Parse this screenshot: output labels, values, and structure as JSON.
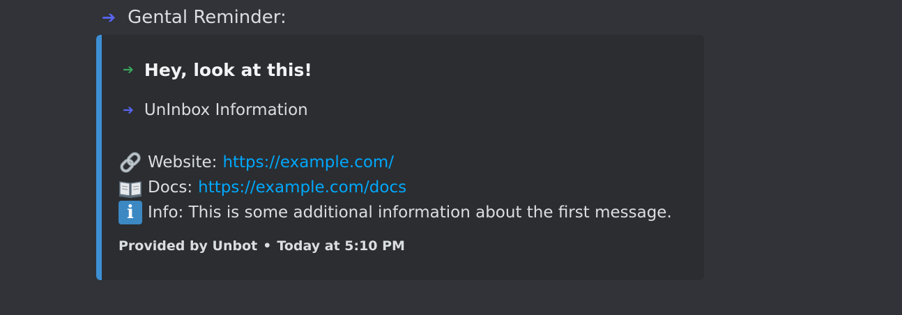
{
  "message": {
    "header_text": "Gental Reminder:",
    "header_icon": "arrow-right-icon"
  },
  "embed": {
    "accent_color": "#3d8fd4",
    "title": "Hey, look at this!",
    "title_icon": "arrow-right-icon",
    "subtitle": "UnInbox Information",
    "subtitle_icon": "arrow-right-icon",
    "fields": [
      {
        "icon": "link-icon",
        "label": "Website:",
        "link": "https://example.com/"
      },
      {
        "icon": "open-book-icon",
        "label": "Docs:",
        "link": "https://example.com/docs"
      },
      {
        "icon": "info-icon",
        "label": "Info: This is some additional information about the first message."
      }
    ],
    "footer": {
      "provider": "Provided by Unbot",
      "separator": "•",
      "timestamp": "Today at 5:10 PM"
    }
  },
  "colors": {
    "background": "#313338",
    "embed_background": "#2b2d31",
    "link": "#00a8fc",
    "arrow_blurple": "#5865f2",
    "arrow_green": "#3ba55c"
  }
}
